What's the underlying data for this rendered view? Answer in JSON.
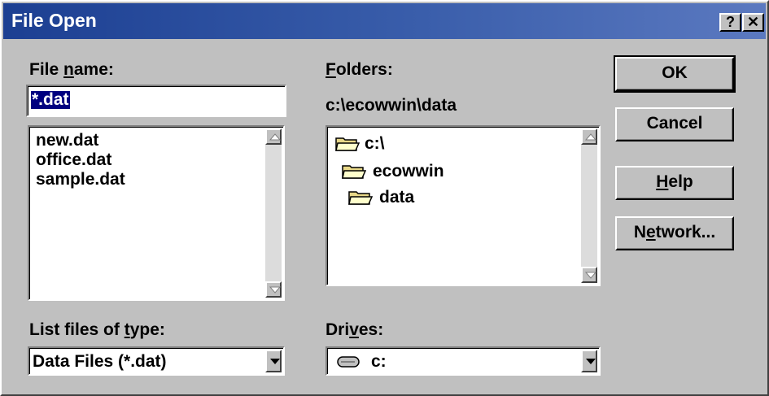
{
  "window": {
    "title": "File Open",
    "help_glyph": "?",
    "close_glyph": "✕"
  },
  "filename": {
    "label_pre": "File ",
    "label_key": "n",
    "label_post": "ame:",
    "value": "*.dat",
    "files": [
      "new.dat",
      "office.dat",
      "sample.dat"
    ]
  },
  "folders": {
    "label_key": "F",
    "label_post": "olders:",
    "current_path": "c:\\ecowwin\\data",
    "items": [
      {
        "label": "c:\\",
        "icon": "folder-open-icon"
      },
      {
        "label": "ecowwin",
        "icon": "folder-open-icon"
      },
      {
        "label": "data",
        "icon": "folder-open-icon"
      }
    ]
  },
  "filetype": {
    "label_pre": "List files of ",
    "label_key": "t",
    "label_post": "ype:",
    "selected": "Data Files (*.dat)"
  },
  "drives": {
    "label_pre": "Dri",
    "label_key": "v",
    "label_post": "es:",
    "selected": "c:",
    "icon": "drive-icon"
  },
  "buttons": {
    "ok": "OK",
    "cancel": "Cancel",
    "help_key": "H",
    "help_post": "elp",
    "network_pre": "N",
    "network_key": "e",
    "network_post": "twork..."
  },
  "colors": {
    "title_bar": "#1c3f92",
    "selection": "#000080",
    "face": "#c0c0c0",
    "folder": "#e8d888"
  }
}
